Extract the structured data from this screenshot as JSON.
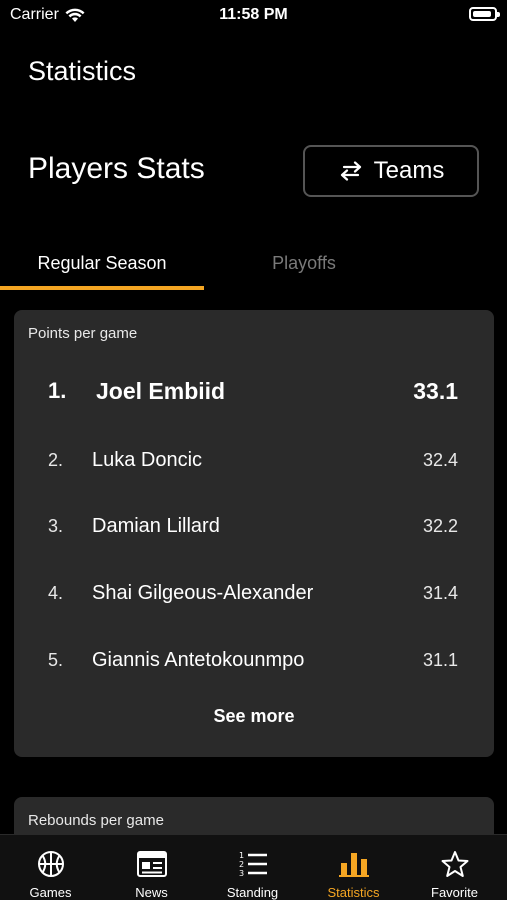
{
  "status_bar": {
    "carrier": "Carrier",
    "time": "11:58 PM",
    "battery_level": 0.9
  },
  "page_title": "Statistics",
  "section_title": "Players Stats",
  "teams_button": {
    "label": "Teams",
    "icon": "swap-arrows-icon"
  },
  "tabs": [
    {
      "label": "Regular Season",
      "active": true
    },
    {
      "label": "Playoffs",
      "active": false
    }
  ],
  "points_card": {
    "heading": "Points per game",
    "rows": [
      {
        "rank": "1.",
        "name": "Joel Embiid",
        "value": "33.1"
      },
      {
        "rank": "2.",
        "name": "Luka Doncic",
        "value": "32.4"
      },
      {
        "rank": "3.",
        "name": "Damian Lillard",
        "value": "32.2"
      },
      {
        "rank": "4.",
        "name": "Shai Gilgeous-Alexander",
        "value": "31.4"
      },
      {
        "rank": "5.",
        "name": "Giannis Antetokounmpo",
        "value": "31.1"
      }
    ],
    "see_more": "See more"
  },
  "rebounds_card": {
    "heading": "Rebounds per game"
  },
  "tab_bar": [
    {
      "label": "Games",
      "icon": "basketball-icon",
      "active": false
    },
    {
      "label": "News",
      "icon": "newspaper-icon",
      "active": false
    },
    {
      "label": "Standing",
      "icon": "numbered-list-icon",
      "active": false
    },
    {
      "label": "Statistics",
      "icon": "bar-chart-icon",
      "active": true
    },
    {
      "label": "Favorite",
      "icon": "star-icon",
      "active": false
    }
  ],
  "colors": {
    "accent": "#f5a623",
    "background": "#000000",
    "card": "#2a2a2a"
  }
}
